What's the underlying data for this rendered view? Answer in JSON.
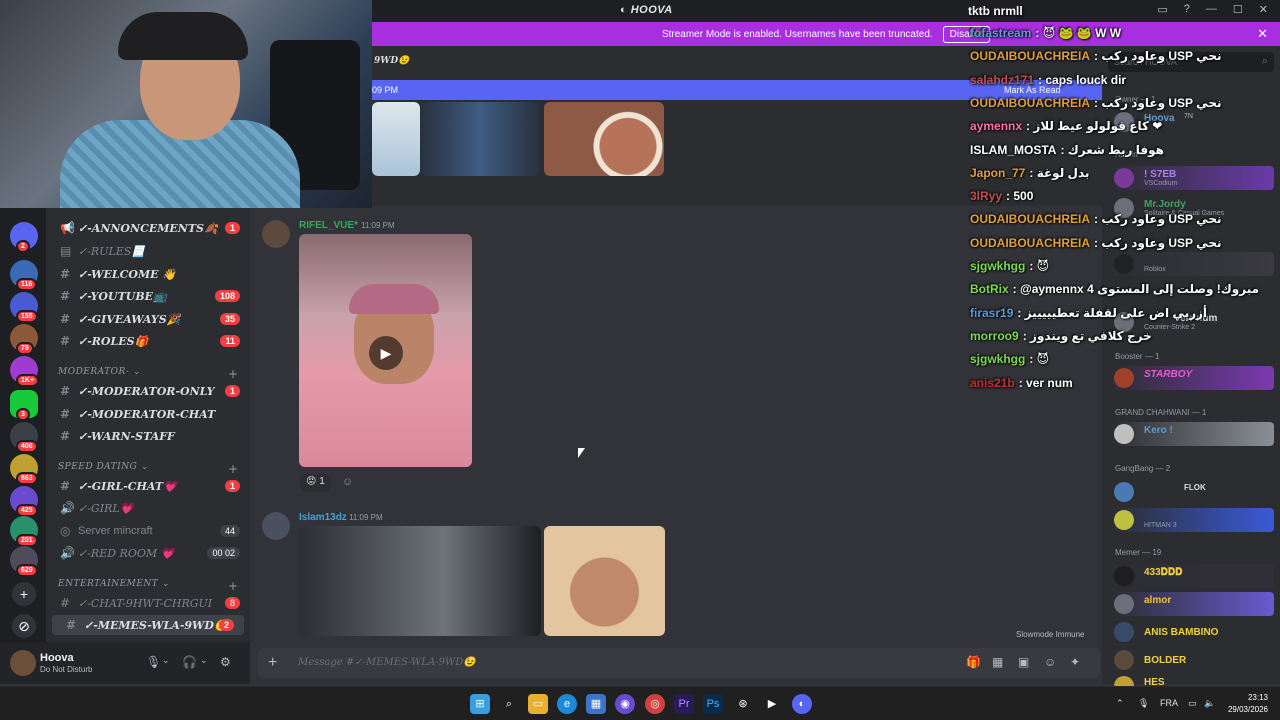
{
  "window": {
    "title": "HOOVA"
  },
  "banner": {
    "text": "Streamer Mode is enabled. Usernames have been truncated.",
    "disable_label": "Disable"
  },
  "servers": [
    "2",
    "116",
    "155",
    "79",
    "1K+",
    "3",
    "406",
    "863",
    "425",
    "201",
    "629"
  ],
  "channels": [
    {
      "name": "✓-ANNONCEMENTS🍂",
      "count": "1"
    },
    {
      "name": "✓-RULES📃",
      "count": ""
    },
    {
      "name": "✓-WELCOME 👋",
      "count": ""
    },
    {
      "name": "✓-YOUTUBE📺",
      "count": "108"
    },
    {
      "name": "✓-GIVEAWAYS🎉",
      "count": "35"
    },
    {
      "name": "✓-ROLES🎁",
      "count": "11"
    }
  ],
  "categories": {
    "moderator": "MODERATOR-",
    "speed_dating": "SPEED DATING",
    "entertainment": "ENTERTAINEMENT"
  },
  "moderator_channels": [
    {
      "name": "✓-MODERATOR-ONLY",
      "count": "1"
    },
    {
      "name": "✓-MODERATOR-CHAT",
      "count": ""
    },
    {
      "name": "✓-WARN-STAFF",
      "count": ""
    }
  ],
  "speed_channels": [
    {
      "name": "✓-GIRL-CHAT💗",
      "count": "1"
    },
    {
      "name": "✓-GIRL💗",
      "count": ""
    },
    {
      "name": "Server mincraft",
      "count": "44"
    },
    {
      "name": "✓-RED ROOM 💗",
      "count": "00 02"
    }
  ],
  "ent_channels": [
    {
      "name": "✓-CHAT-9HWT-CHRGUI",
      "count": "8"
    },
    {
      "name": "✓-MEMES-WLA-9WD😉",
      "count": "2"
    }
  ],
  "user": {
    "name": "Hoova",
    "status": "Do Not Disturb"
  },
  "messages": {
    "top_partial_channel": "9WD😉",
    "readbar_time": "09 PM",
    "readbar_label": "Mark As Read",
    "msg1_author": "RIFEL_VUE*",
    "msg1_time": "11:09 PM",
    "msg1_reaction_count": "1",
    "msg2_author": "Islam13dz",
    "msg2_time": "11:09 PM",
    "slowmode": "Slowmode Immune"
  },
  "composer": {
    "placeholder": "Message #✓-MEMES-WLA-9WD😉"
  },
  "members": {
    "search_placeholder": "Search HOOVA",
    "groups": [
      "Owner — 1",
      "Admin — 2",
      "Booster — 1",
      "GRAND CHAHWANI — 1",
      "GangBang — 2",
      "Memer — 19"
    ],
    "list": [
      {
        "name": "Hoova",
        "sub": "7N"
      },
      {
        "name": "! S7EB",
        "sub": "VSCodium"
      },
      {
        "name": "Mr.Jordy",
        "sub": "Solitaire & Casual Games"
      },
      {
        "name": "",
        "sub": "Roblox"
      },
      {
        "name": "Verr num",
        "sub": "Counter-Strike 2"
      },
      {
        "name": "STARBOY",
        "sub": ""
      },
      {
        "name": "Kero !",
        "sub": ""
      },
      {
        "name": "FLOK",
        "sub": ""
      },
      {
        "name": "",
        "sub": "HITMAN 3"
      },
      {
        "name": "433𝐃𝐃𝐃",
        "sub": ""
      },
      {
        "name": "almor",
        "sub": ""
      },
      {
        "name": "ANIS BAMBINO",
        "sub": ""
      },
      {
        "name": "BOLDER",
        "sub": ""
      },
      {
        "name": "HES",
        "sub": ""
      }
    ]
  },
  "overlay": {
    "title": "tktb nrmll",
    "lines": [
      {
        "user": "fofastream",
        "text": ": 😈 🐸 🐸 W W",
        "color": "#5b9bd5"
      },
      {
        "user": "OUDAIBOUACHREIA",
        "text": ": وعاود ركب USP نحي",
        "color": "#e0a040"
      },
      {
        "user": "salahdz171",
        "text": ": caps louck dir",
        "color": "#c05050"
      },
      {
        "user": "OUDAIBOUACHREIA",
        "text": ": وعاود ركب USP نحي",
        "color": "#e0a040"
      },
      {
        "user": "aymennx",
        "text": ": كاع قولولو عيط للاز ❤",
        "color": "#ff6fa0"
      },
      {
        "user": "ISLAM_MOSTA",
        "text": ": هوفا ربط شعرك",
        "color": "#ffffff"
      },
      {
        "user": "Japon_77",
        "text": ": بدل لوغة",
        "color": "#e0a040"
      },
      {
        "user": "3lRyy",
        "text": ": 500",
        "color": "#c05050"
      },
      {
        "user": "OUDAIBOUACHREIA",
        "text": ": وعاود ركب USP نحي",
        "color": "#e0a040"
      },
      {
        "user": "OUDAIBOUACHREIA",
        "text": ": وعاود ركب USP نحي",
        "color": "#e0a040"
      },
      {
        "user": "sjgwkhgg",
        "text": ": 😈",
        "color": "#7ed957"
      },
      {
        "user": "BotRix",
        "text": ": @aymennx مبروك! وصلت إلى المستوى 4",
        "color": "#7ed957"
      },
      {
        "user": "firasr19",
        "text": ": أزربي اض على لقفلة تعطيييييز",
        "color": "#5b9bd5"
      },
      {
        "user": "morroo9",
        "text": ": خرج كلافي تع ويندوز",
        "color": "#7ed957"
      },
      {
        "user": "sjgwkhgg",
        "text": ": 😈",
        "color": "#7ed957"
      },
      {
        "user": "anis21b",
        "text": ": ver num",
        "color": "#c03030"
      }
    ]
  },
  "taskbar": {
    "lang": "FRA",
    "time": "23:13",
    "date": "29/03/2026"
  }
}
